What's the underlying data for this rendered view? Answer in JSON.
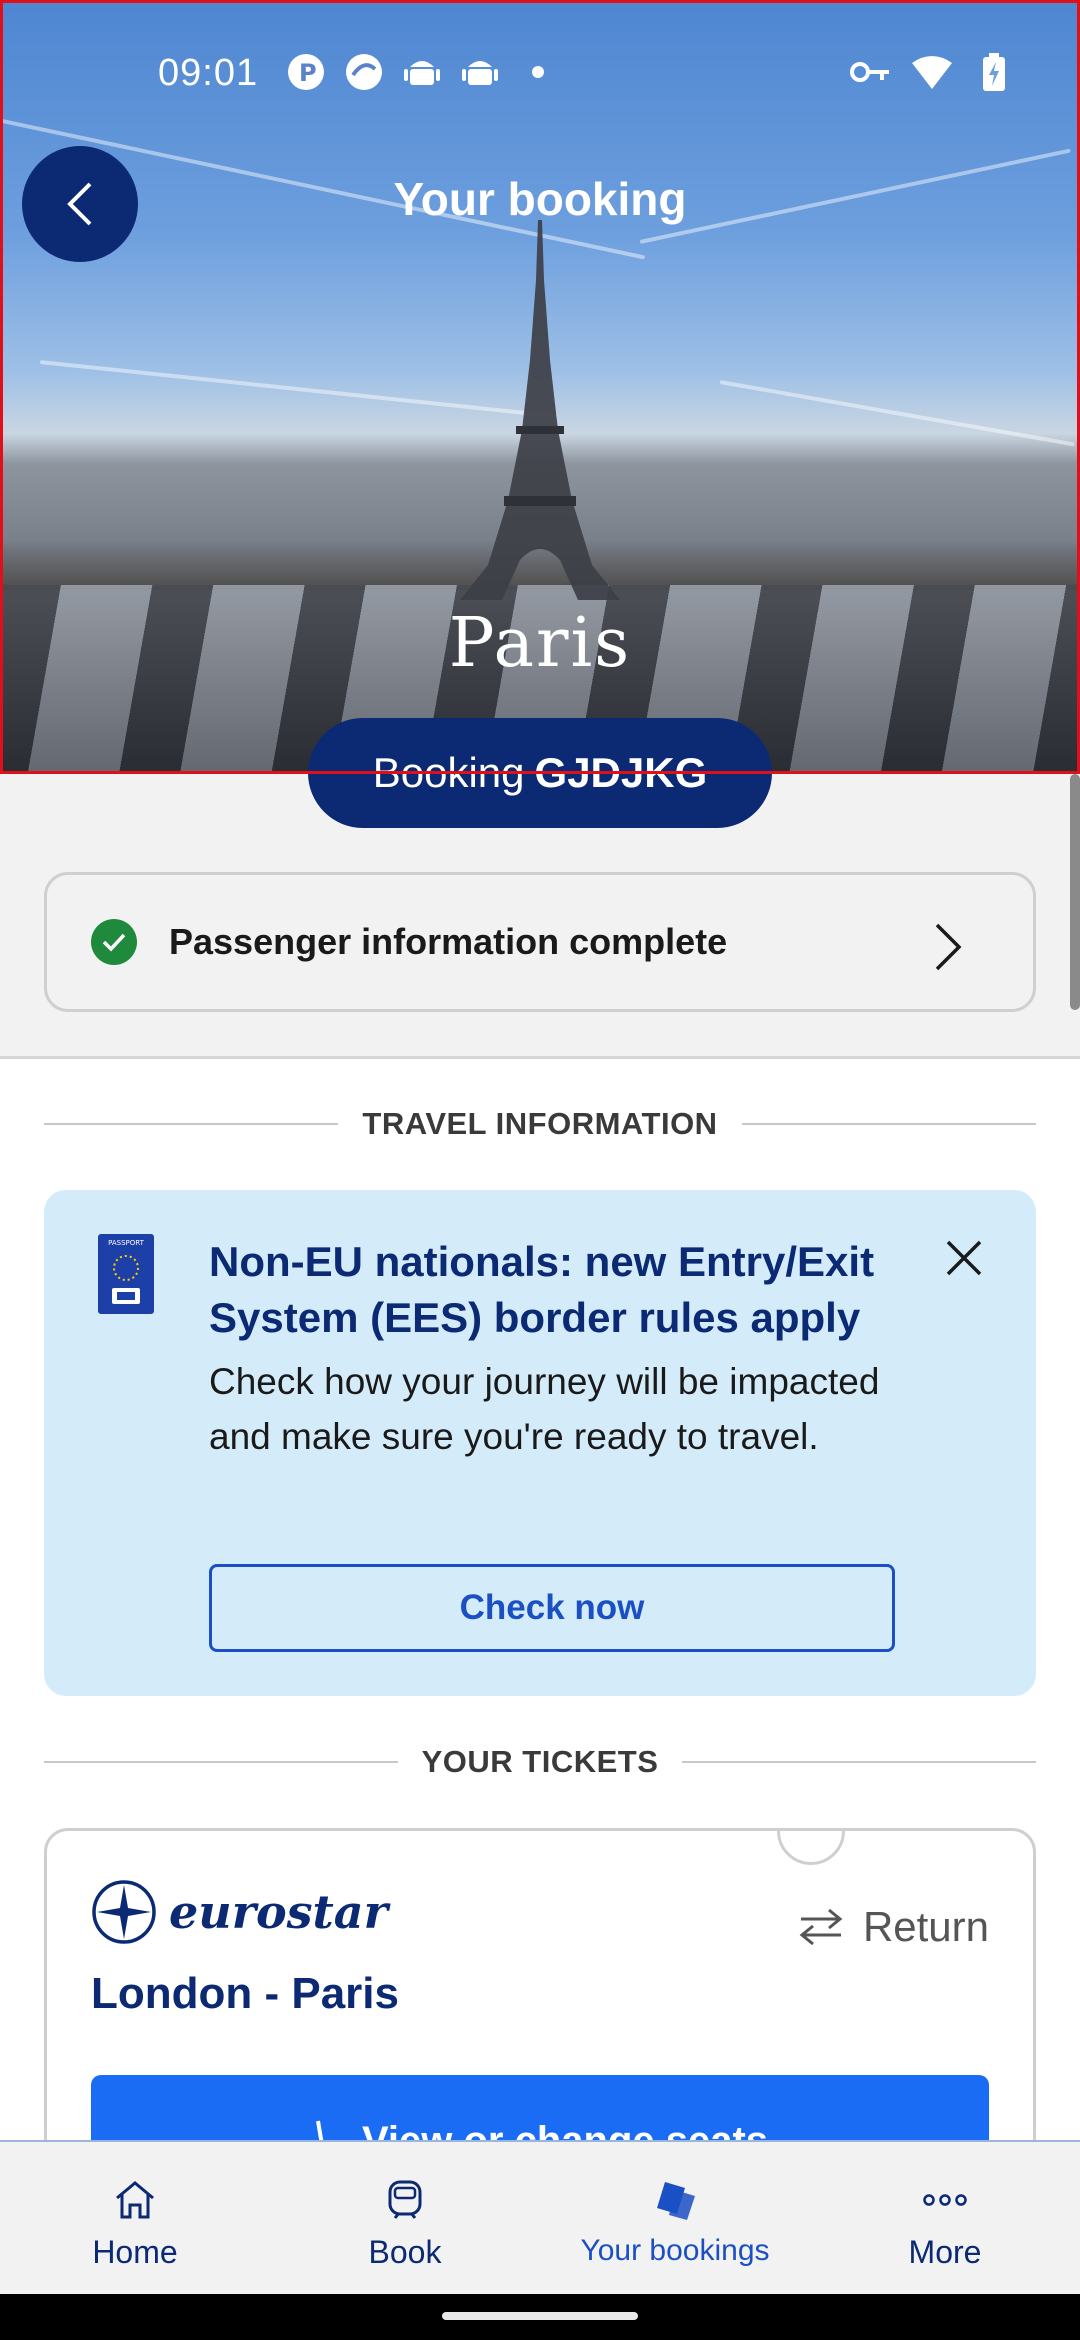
{
  "status_bar": {
    "time": "09:01",
    "left_icons": [
      "app-icon-p",
      "app-icon-circle",
      "android-icon",
      "android-icon",
      "dot-icon"
    ],
    "right_icons": [
      "vpn-key-icon",
      "wifi-icon",
      "battery-charging-icon"
    ]
  },
  "header": {
    "title": "Your booking",
    "city": "Paris",
    "booking_prefix": "Booking",
    "booking_code": "GJDJKG"
  },
  "passenger_status": {
    "label": "Passenger information complete",
    "status_color": "#1f8a3c"
  },
  "travel_info": {
    "heading": "TRAVEL INFORMATION",
    "title": "Non-EU nationals: new Entry/Exit System (EES) border rules apply",
    "body": "Check how your journey will be impacted and make sure you're ready to travel.",
    "button_label": "Check now",
    "passport_text": "PASSPORT"
  },
  "tickets": {
    "heading": "YOUR TICKETS",
    "brand": "eurostar",
    "trip_type": "Return",
    "route": "London - Paris",
    "seat_button_label": "View or change seats"
  },
  "bottom_nav": {
    "items": [
      {
        "label": "Home",
        "icon": "home-icon"
      },
      {
        "label": "Book",
        "icon": "train-icon"
      },
      {
        "label": "Your bookings",
        "icon": "tickets-icon",
        "active": true
      },
      {
        "label": "More",
        "icon": "more-icon"
      }
    ]
  },
  "colors": {
    "brand_navy": "#0b2a73",
    "accent_blue": "#1b4fc4",
    "button_blue": "#1a6cf5",
    "info_bg": "#d4ecfa"
  }
}
